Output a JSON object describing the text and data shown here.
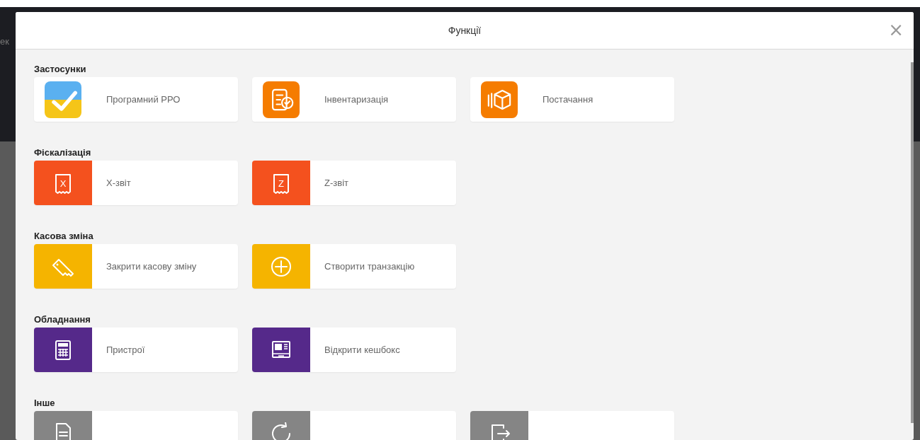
{
  "backdrop_text": "ек",
  "dialog": {
    "title": "Функції",
    "close": "×"
  },
  "sections": [
    {
      "title": "Застосунки",
      "items": [
        {
          "kind": "app",
          "color": "#f5c518",
          "label": "Програмний РРО"
        },
        {
          "kind": "app",
          "color": "#f57c00",
          "label": "Інвентаризація"
        },
        {
          "kind": "app",
          "color": "#f57c00",
          "label": "Постачання"
        }
      ]
    },
    {
      "title": "Фіскалізація",
      "items": [
        {
          "kind": "block",
          "icon_letter": "X",
          "color": "#f4511e",
          "label": "X-звіт"
        },
        {
          "kind": "block",
          "icon_letter": "Z",
          "color": "#f4511e",
          "label": "Z-звіт"
        }
      ]
    },
    {
      "title": "Касова зміна",
      "items": [
        {
          "kind": "block",
          "color": "#f5b400",
          "label": "Закрити касову зміну"
        },
        {
          "kind": "block",
          "color": "#f5b400",
          "label": "Створити транзакцію"
        }
      ]
    },
    {
      "title": "Обладнання",
      "items": [
        {
          "kind": "block",
          "color": "#55298a",
          "label": "Пристрої"
        },
        {
          "kind": "block",
          "color": "#55298a",
          "label": "Відкрити кешбокс"
        }
      ]
    },
    {
      "title": "Інше",
      "items": [
        {
          "kind": "block",
          "color": "#858585"
        },
        {
          "kind": "block",
          "color": "#858585"
        },
        {
          "kind": "block",
          "color": "#858585"
        }
      ]
    }
  ]
}
